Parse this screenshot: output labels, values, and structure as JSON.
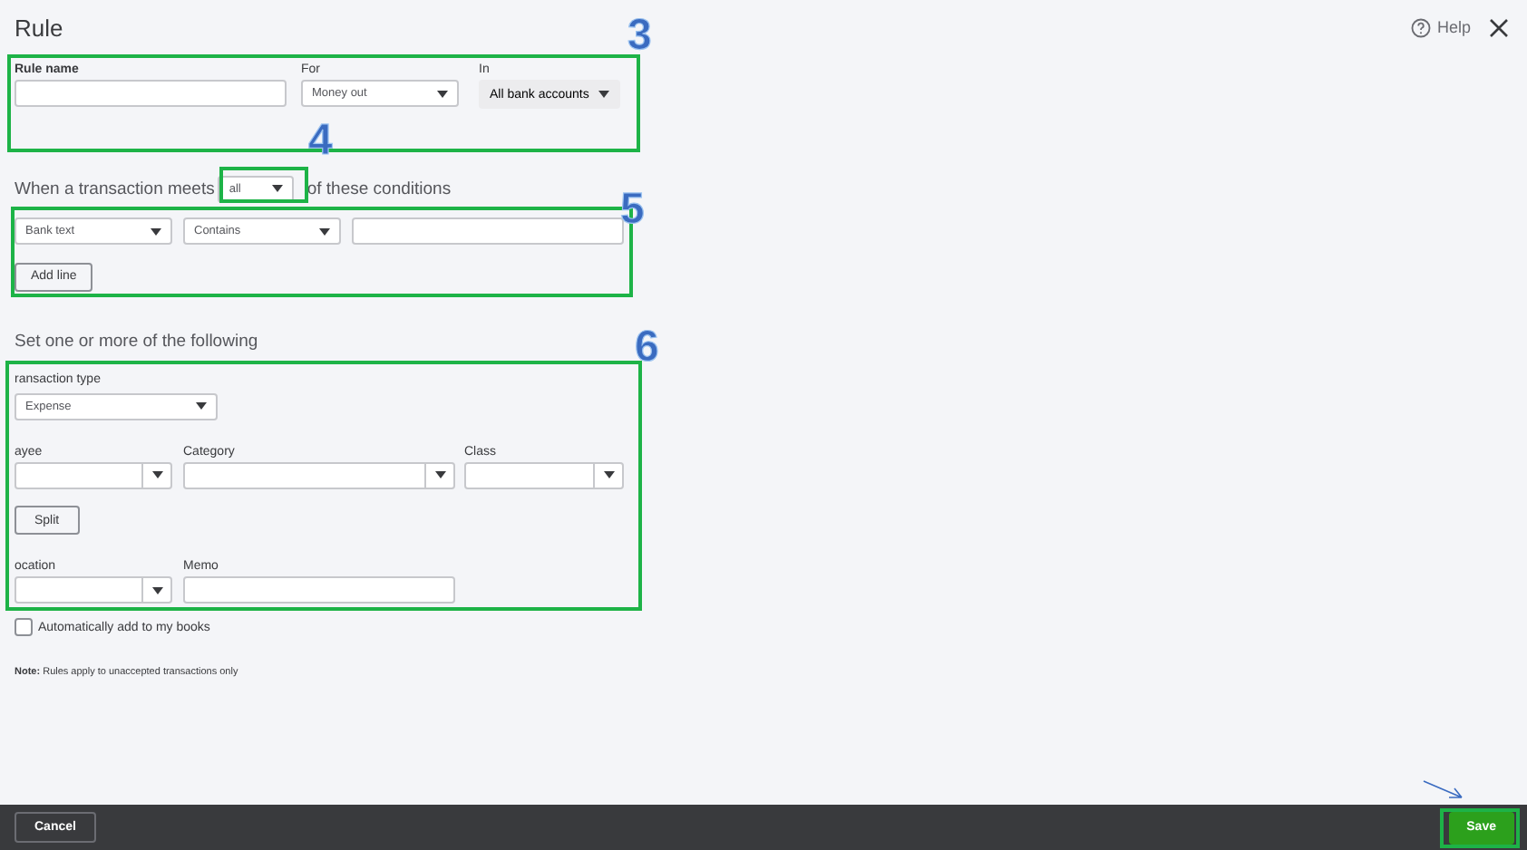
{
  "title": "Rule",
  "help": "Help",
  "rule_fields": [
    {
      "kind": "text",
      "label": "Rule name"
    },
    {
      "kind": "select",
      "label": "For",
      "value": "Money out"
    },
    {
      "kind": "button",
      "label": "In",
      "value": "All bank accounts"
    }
  ],
  "conditions": {
    "prefix": "When a transaction meets",
    "match": "all",
    "suffix": "of these conditions",
    "rows": [
      {
        "field": "Bank text",
        "operator": "Contains"
      }
    ],
    "add_line": "Add line"
  },
  "actions": {
    "heading": "Set one or more of the following",
    "transaction_type": {
      "label": "ransaction type",
      "value": "Expense"
    },
    "payee": {
      "label": "ayee"
    },
    "category": {
      "label": "Category"
    },
    "class": {
      "label": "Class"
    },
    "split": "Split",
    "location": {
      "label": "ocation"
    },
    "memo": {
      "label": "Memo"
    }
  },
  "auto_add": {
    "label": "Automatically add to my books",
    "checked": false
  },
  "note": "**Note:** Rules apply to unaccepted transactions only",
  "footer": {
    "cancel": "Cancel",
    "save": "Save"
  },
  "annotations": [
    {
      "kind": "box",
      "label": "3"
    },
    {
      "kind": "box",
      "label": "4"
    },
    {
      "kind": "box",
      "label": "5"
    },
    {
      "kind": "box",
      "label": "6"
    },
    {
      "kind": "box"
    },
    {
      "kind": "arrow"
    }
  ]
}
